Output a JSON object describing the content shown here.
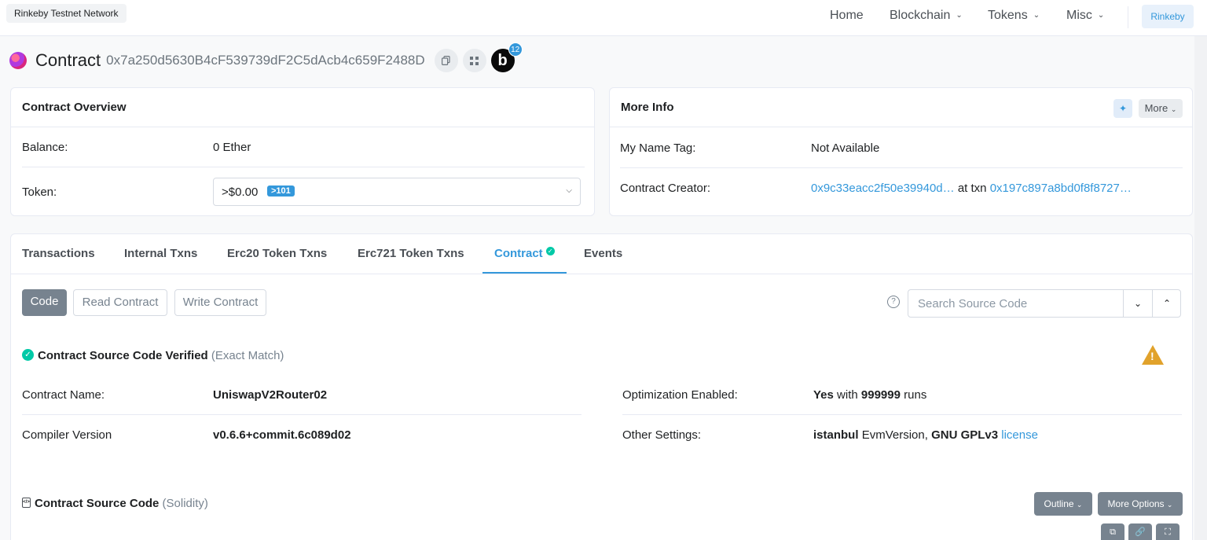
{
  "network_badge": "Rinkeby Testnet Network",
  "nav": {
    "home": "Home",
    "blockchain": "Blockchain",
    "tokens": "Tokens",
    "misc": "Misc",
    "network": "Rinkeby"
  },
  "header": {
    "title": "Contract",
    "address": "0x7a250d5630B4cF539739dF2C5dAcb4c659F2488D",
    "blockscan_letter": "b",
    "blockscan_count": "12"
  },
  "overview": {
    "title": "Contract Overview",
    "balance_label": "Balance:",
    "balance_value": "0 Ether",
    "token_label": "Token:",
    "token_value": ">$0.00",
    "token_badge": ">101"
  },
  "more_info": {
    "title": "More Info",
    "more_button": "More",
    "name_tag_label": "My Name Tag:",
    "name_tag_value": "Not Available",
    "creator_label": "Contract Creator:",
    "creator_address": "0x9c33eacc2f50e39940d…",
    "creator_at_txn": "at txn",
    "creator_txn": "0x197c897a8bd0f8f8727…"
  },
  "tabs": [
    {
      "label": "Transactions"
    },
    {
      "label": "Internal Txns"
    },
    {
      "label": "Erc20 Token Txns"
    },
    {
      "label": "Erc721 Token Txns"
    },
    {
      "label": "Contract"
    },
    {
      "label": "Events"
    }
  ],
  "code_toolbar": {
    "code": "Code",
    "read": "Read Contract",
    "write": "Write Contract",
    "help": "?",
    "search_placeholder": "Search Source Code"
  },
  "verified": {
    "title": "Contract Source Code Verified",
    "note": "(Exact Match)"
  },
  "details": {
    "name_label": "Contract Name:",
    "name_value": "UniswapV2Router02",
    "compiler_label": "Compiler Version",
    "compiler_value": "v0.6.6+commit.6c089d02",
    "optimization_label": "Optimization Enabled:",
    "optimization_yes": "Yes",
    "optimization_with": "with",
    "optimization_runs": "999999",
    "optimization_runs_suffix": "runs",
    "settings_label": "Other Settings:",
    "settings_evm": "istanbul",
    "settings_evm_suffix": "EvmVersion,",
    "settings_license": "GNU GPLv3",
    "settings_license_link": "license"
  },
  "source": {
    "title": "Contract Source Code",
    "lang": "(Solidity)",
    "outline": "Outline",
    "more_options": "More Options"
  },
  "colors": {
    "accent": "#3498db",
    "success": "#00c9a7",
    "warning": "#e1a22b",
    "button_dark": "#77838f"
  }
}
